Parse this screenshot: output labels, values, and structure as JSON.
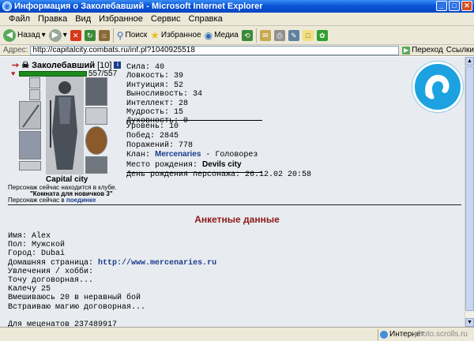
{
  "window": {
    "title": "Информация о Заколебавший - Microsoft Internet Explorer"
  },
  "menu": [
    "Файл",
    "Правка",
    "Вид",
    "Избранное",
    "Сервис",
    "Справка"
  ],
  "toolbar": {
    "back": "Назад",
    "search": "Поиск",
    "favorites": "Избранное",
    "media": "Медиа"
  },
  "address": {
    "label": "Адрес:",
    "url": "http://capitalcity.combats.ru/inf.pl?1040925518",
    "go": "Переход",
    "links": "Ссылки"
  },
  "character": {
    "name": "Заколебавший",
    "level": "[10]",
    "hp": "557/557",
    "hp_fraction": 1.0,
    "city": "Capital city",
    "location_note": "Персонаж сейчас находится в клубе.",
    "room": "\"Комната для новичков 3\"",
    "duel_prefix": "Персонаж сейчас в",
    "duel_link": "поединке"
  },
  "stats": [
    {
      "label": "Сила:",
      "value": "40"
    },
    {
      "label": "Ловкость:",
      "value": "39"
    },
    {
      "label": "Интуиция:",
      "value": "52"
    },
    {
      "label": "Выносливость:",
      "value": "34"
    },
    {
      "label": "Интеллект:",
      "value": "28"
    },
    {
      "label": "Мудрость:",
      "value": "15"
    },
    {
      "label": "Духовность:",
      "value": "0"
    }
  ],
  "record": {
    "level_label": "Уровень:",
    "level": "10",
    "wins_label": "Побед:",
    "wins": "2845",
    "losses_label": "Поражений:",
    "losses": "778",
    "clan_label": "Клан:",
    "clan": "Mercenaries",
    "clan_rank": "- Головорез",
    "birthplace_label": "Место рождения:",
    "birthplace": "Devils city",
    "birthday_label": "День рождения персонажа:",
    "birthday": "26.12.02 20:58"
  },
  "anket": {
    "title": "Анкетные данные",
    "name": "Имя: Alex",
    "sex": "Пол: Мужской",
    "city": "Город: Dubai",
    "homepage_label": "Домашняя страница:",
    "homepage": "http://www.mercenaries.ru",
    "hobby_label": "Увлечения / хобби:",
    "lines": [
      "Точу договорная...",
      "Калечу 25",
      "Вмешиваюсь 20 в неравный бой",
      "Встраиваю магию договорная..."
    ],
    "donate": "Для меценатов 237489917"
  },
  "status": {
    "zone": "Интернет"
  },
  "watermark": "photo.scrolls.ru",
  "colors": {
    "titlebar": "#0a55d8",
    "hp": "#1e8a1e",
    "anket_title": "#8c1818",
    "link": "#1a3c8c"
  }
}
